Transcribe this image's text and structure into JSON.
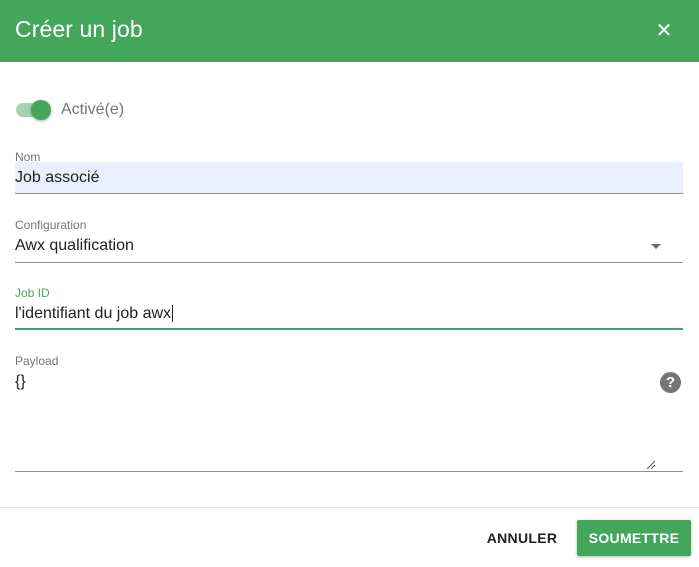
{
  "dialog": {
    "title": "Créer un job",
    "close_icon": "close-icon"
  },
  "toggle": {
    "label": "Activé(e)",
    "checked": true,
    "accent": "#43a65b"
  },
  "fields": {
    "nom": {
      "label": "Nom",
      "value": "Job associé"
    },
    "configuration": {
      "label": "Configuration",
      "value": "Awx qualification"
    },
    "job_id": {
      "label": "Job ID",
      "value": "l'identifiant du job awx"
    },
    "payload": {
      "label": "Payload",
      "value": "{}",
      "help_icon": "help-icon"
    }
  },
  "actions": {
    "cancel_label": "ANNULER",
    "submit_label": "SOUMETTRE"
  },
  "colors": {
    "header": "#43a65b",
    "autofill": "#e8f0fe",
    "muted": "#757575"
  }
}
